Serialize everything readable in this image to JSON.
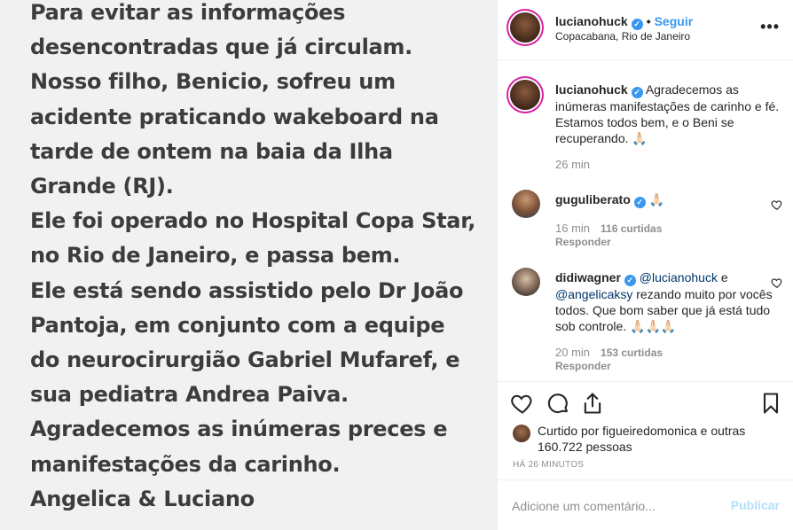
{
  "post_image": {
    "lines": [
      "Para evitar as informações",
      "desencontradas que já circulam.",
      "Nosso filho, Benicio, sofreu um",
      "acidente praticando wakeboard na",
      "tarde de ontem na baia da Ilha",
      "Grande (RJ).",
      "Ele foi operado no Hospital Copa Star,",
      "no Rio de Janeiro, e passa bem.",
      "Ele está sendo assistido pelo Dr João",
      "Pantoja, em conjunto com a equipe",
      "do neurocirurgião Gabriel Mufaref, e",
      "sua pediatra Andrea Paiva.",
      "Agradecemos as inúmeras preces e",
      "manifestações da carinho.",
      "Angelica & Luciano"
    ]
  },
  "header": {
    "username": "lucianohuck",
    "dot": "•",
    "follow_label": "Seguir",
    "location": "Copacabana, Rio de Janeiro",
    "more": "•••"
  },
  "caption": {
    "username": "lucianohuck",
    "text": "Agradecemos as inúmeras manifestações de carinho e fé. Estamos todos bem, e o Beni se recuperando. 🙏🏻",
    "time": "26 min"
  },
  "comments": [
    {
      "username": "guguliberato",
      "text": "🙏🏻",
      "time": "16 min",
      "likes": "116 curtidas",
      "reply": "Responder"
    },
    {
      "username": "didiwagner",
      "mention1": "@lucianohuck",
      "mid": " e ",
      "mention2": "@angelicaksy",
      "text": " rezando muito por vocês todos. Que bom saber que já está tudo sob controle. 🙏🏻🙏🏻🙏🏻",
      "time": "20 min",
      "likes": "153 curtidas",
      "reply": "Responder"
    }
  ],
  "likes": {
    "prefix": "Curtido por ",
    "user": "figueiredomonica",
    "middle": " e ",
    "others": "outras 160.722 pessoas"
  },
  "ago": "HÁ 26 MINUTOS",
  "comment_box": {
    "placeholder": "Adicione um comentário...",
    "publish_label": "Publicar"
  },
  "colors": {
    "accent": "#3897f0",
    "publish_disabled": "#b2dffc",
    "muted": "#8e8e8e",
    "text": "#262626"
  }
}
